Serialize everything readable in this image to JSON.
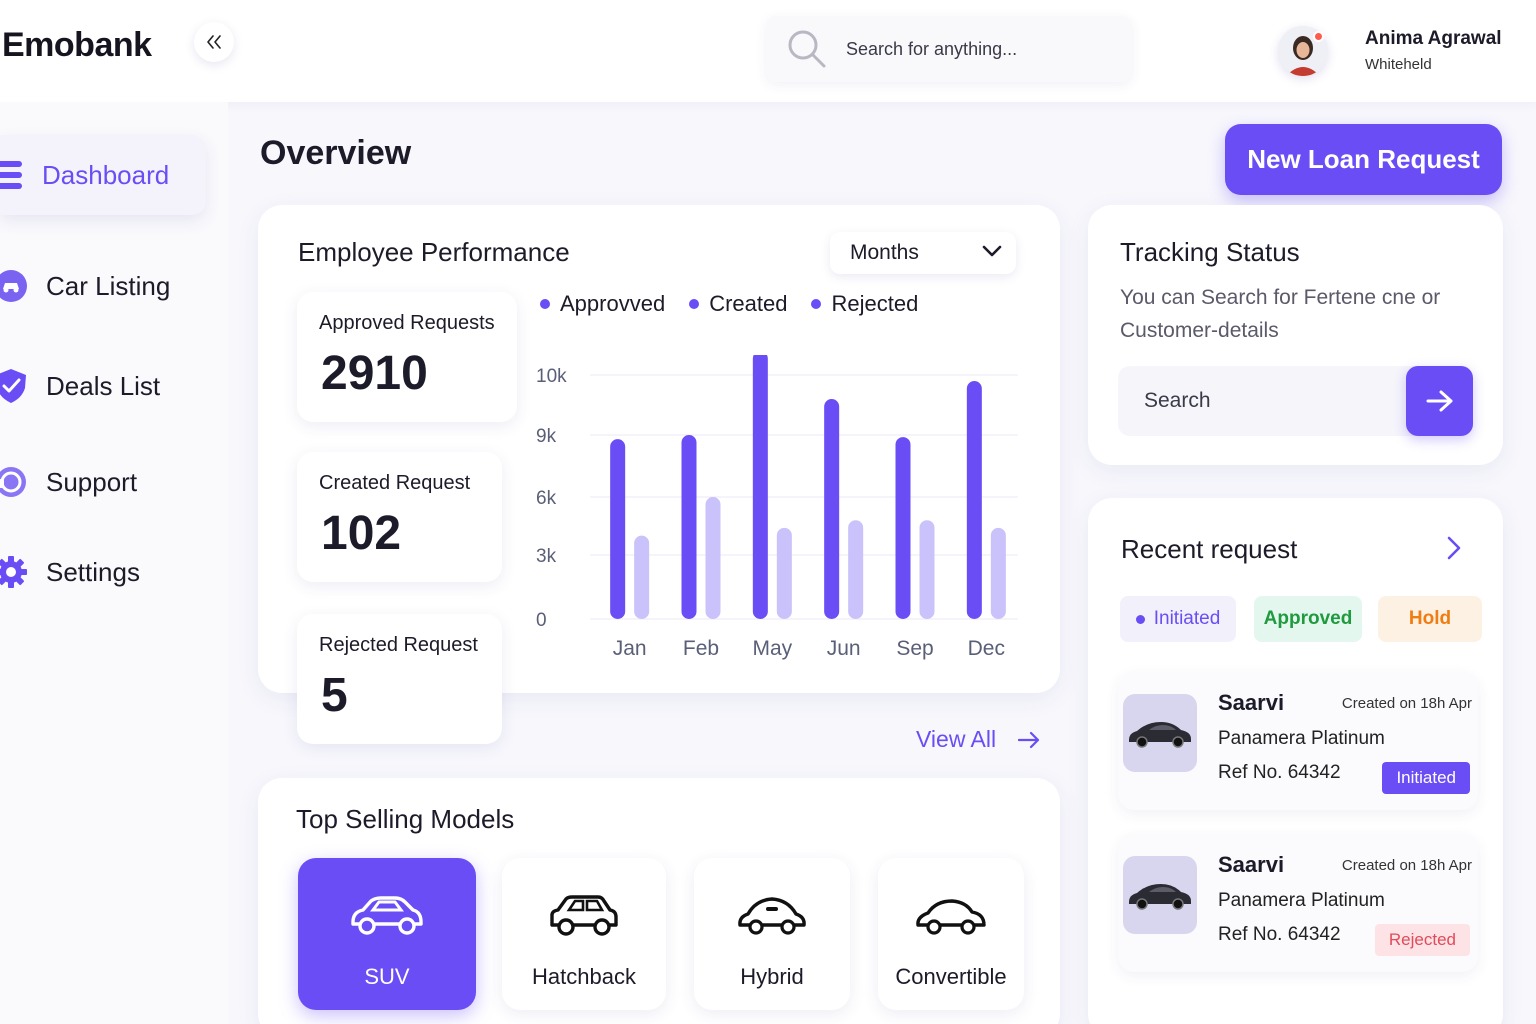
{
  "app": {
    "logo": "Emobank"
  },
  "search": {
    "placeholder": "Search for anything..."
  },
  "user": {
    "name": "Anima Agrawal",
    "subtitle": "Whiteheld"
  },
  "sidebar": {
    "items": [
      {
        "label": "Dashboard",
        "icon": "menu-icon",
        "active": true
      },
      {
        "label": "Car Listing",
        "icon": "car-badge-icon"
      },
      {
        "label": "Deals List",
        "icon": "shield-check-icon"
      },
      {
        "label": "Support",
        "icon": "support-icon"
      },
      {
        "label": "Settings",
        "icon": "gear-icon"
      }
    ]
  },
  "main": {
    "title": "Overview",
    "new_loan_label": "New Loan Request",
    "performance": {
      "title": "Employee Performance",
      "period": "Months",
      "stats": [
        {
          "label": "Approved Requests",
          "value": "2910"
        },
        {
          "label": "Created Request",
          "value": "102"
        },
        {
          "label": "Rejected Request",
          "value": "5"
        }
      ],
      "legend": [
        "Approvved",
        "Created",
        "Rejected"
      ]
    },
    "view_all": "View All",
    "models": {
      "title": "Top Selling Models",
      "items": [
        {
          "label": "SUV",
          "icon": "suv-icon",
          "active": true
        },
        {
          "label": "Hatchback",
          "icon": "hatchback-icon"
        },
        {
          "label": "Hybrid",
          "icon": "hybrid-car-icon"
        },
        {
          "label": "Convertible",
          "icon": "convertible-icon"
        }
      ]
    }
  },
  "tracking": {
    "title": "Tracking Status",
    "description": "You can Search for Fertene cne or Customer-details",
    "search_placeholder": "Search"
  },
  "recent": {
    "title": "Recent request",
    "filters": [
      "Initiated",
      "Approved",
      "Hold"
    ],
    "items": [
      {
        "name": "Saarvi",
        "date": "Created on 18h Apr",
        "model": "Panamera Platinum",
        "ref": "Ref No. 64342",
        "status": "Initiated"
      },
      {
        "name": "Saarvi",
        "date": "Created on 18h Apr",
        "model": "Panamera Platinum",
        "ref": "Ref No. 64342",
        "status": "Rejected"
      }
    ]
  },
  "chart_data": {
    "type": "bar",
    "categories": [
      "Jan",
      "Feb",
      "May",
      "Jun",
      "Sep",
      "Dec"
    ],
    "series": [
      {
        "name": "Approvved",
        "values": [
          8800,
          9000,
          10400,
          9600,
          8900,
          9900
        ],
        "color": "#6a4df5"
      },
      {
        "name": "Created",
        "values": [
          4000,
          6000,
          4400,
          4800,
          4800,
          4400
        ],
        "color": "#c9c2fb"
      }
    ],
    "yticks": [
      {
        "label": "0",
        "value": 0
      },
      {
        "label": "3k",
        "value": 3000
      },
      {
        "label": "6k",
        "value": 6000
      },
      {
        "label": "9k",
        "value": 9000
      },
      {
        "label": "10k",
        "value": 10000
      }
    ],
    "grid": true,
    "colors": {
      "accent": "#6a4df5",
      "light": "#c9c2fb"
    }
  }
}
